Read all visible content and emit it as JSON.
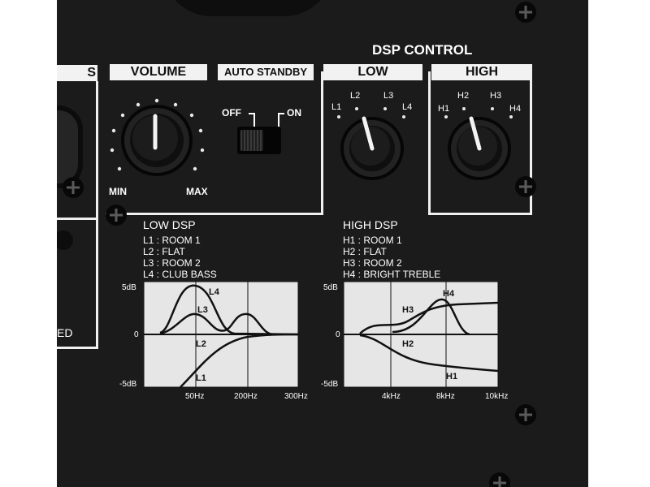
{
  "partial_left_label": "S",
  "partial_left_bottom_label": "ED",
  "volume": {
    "label": "VOLUME",
    "min_label": "MIN",
    "max_label": "MAX"
  },
  "auto_standby": {
    "label": "AUTO STANDBY",
    "off_label": "OFF",
    "on_label": "ON",
    "state": "off"
  },
  "dsp_control": {
    "title": "DSP CONTROL",
    "low": {
      "label": "LOW",
      "positions": [
        "L1",
        "L2",
        "L3",
        "L4"
      ],
      "selected": "L2"
    },
    "high": {
      "label": "HIGH",
      "positions": [
        "H1",
        "H2",
        "H3",
        "H4"
      ],
      "selected": "H2"
    }
  },
  "low_dsp": {
    "title": "LOW DSP",
    "modes": [
      "L1 : ROOM 1",
      "L2 : FLAT",
      "L3 : ROOM 2",
      "L4 : CLUB BASS"
    ],
    "y_labels": [
      "5dB",
      "0",
      "-5dB"
    ],
    "x_labels": [
      "50Hz",
      "200Hz",
      "300Hz"
    ],
    "curve_labels": [
      "L4",
      "L3",
      "L2",
      "L1"
    ]
  },
  "high_dsp": {
    "title": "HIGH DSP",
    "modes": [
      "H1 : ROOM 1",
      "H2 : FLAT",
      "H3 : ROOM 2",
      "H4 : BRIGHT TREBLE"
    ],
    "y_labels": [
      "5dB",
      "0",
      "-5dB"
    ],
    "x_labels": [
      "4kHz",
      "8kHz",
      "10kHz"
    ],
    "curve_labels": [
      "H4",
      "H3",
      "H2",
      "H1"
    ]
  },
  "colors": {
    "panel": "#1b1b1b",
    "label_bg": "#f2f2f2",
    "text": "#ffffff",
    "graph_bg": "#e6e6e6"
  }
}
